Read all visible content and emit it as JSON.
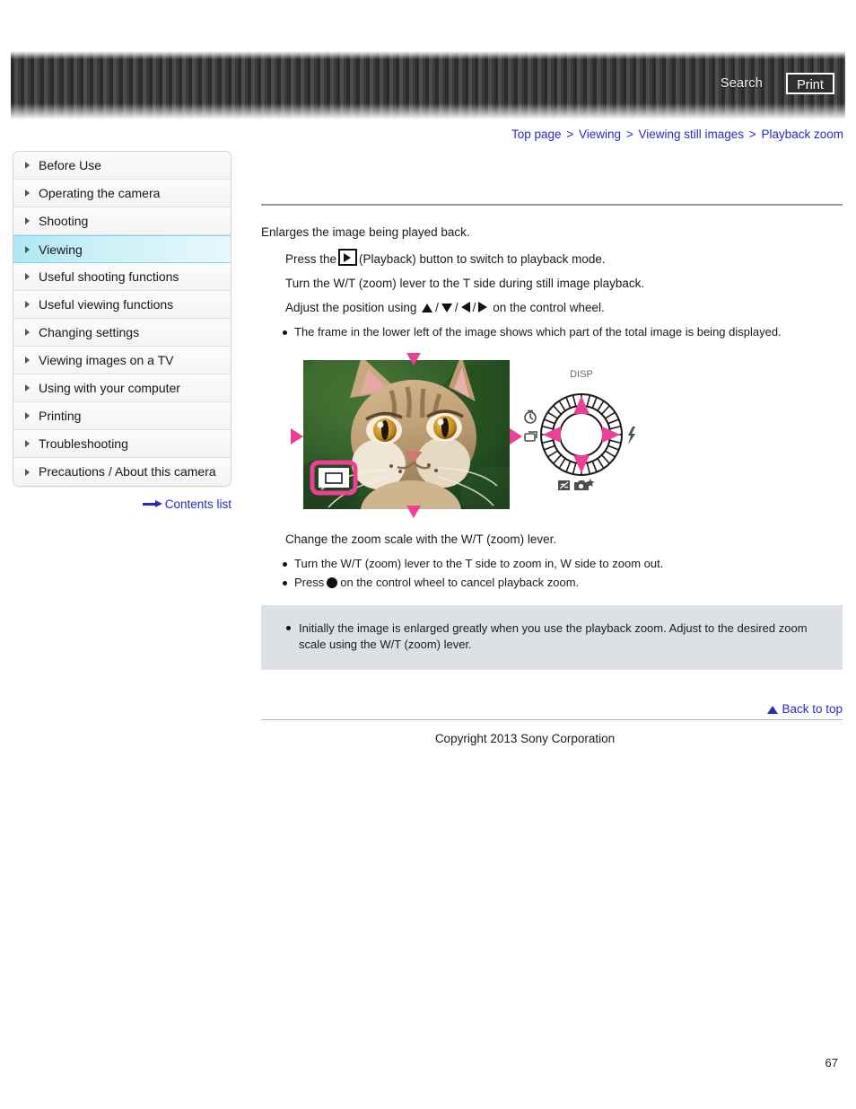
{
  "header": {
    "search_label": "Search",
    "print_label": "Print"
  },
  "breadcrumb": {
    "items": [
      "Top page",
      "Viewing",
      "Viewing still images",
      "Playback zoom"
    ],
    "separator": ">"
  },
  "sidebar": {
    "items": [
      {
        "label": "Before Use",
        "active": false
      },
      {
        "label": "Operating the camera",
        "active": false
      },
      {
        "label": "Shooting",
        "active": false
      },
      {
        "label": "Viewing",
        "active": true
      },
      {
        "label": "Useful shooting functions",
        "active": false
      },
      {
        "label": "Useful viewing functions",
        "active": false
      },
      {
        "label": "Changing settings",
        "active": false
      },
      {
        "label": "Viewing images on a TV",
        "active": false
      },
      {
        "label": "Using with your computer",
        "active": false
      },
      {
        "label": "Printing",
        "active": false
      },
      {
        "label": "Troubleshooting",
        "active": false
      },
      {
        "label": "Precautions / About this camera",
        "active": false
      }
    ],
    "contents_list_label": "Contents list"
  },
  "main": {
    "lead": "Enlarges the image being played back.",
    "step1_pre": "Press the",
    "step1_post": "(Playback) button to switch to playback mode.",
    "step2": "Turn the W/T (zoom) lever to the T side during still image playback.",
    "step3_pre": "Adjust the position using",
    "step3_post": "on the control wheel.",
    "step3_note": "The frame in the lower left of the image shows which part of the total image is being displayed.",
    "step4": "Change the zoom scale with the W/T (zoom) lever.",
    "step4_note1": "Turn the W/T (zoom) lever to the T side to zoom in, W side to zoom out.",
    "step4_note2_pre": "Press",
    "step4_note2_post": "on the control wheel to cancel playback zoom."
  },
  "illustration": {
    "wheel_labels": {
      "top": "DISP",
      "left_upper": "self-timer-icon",
      "left_lower": "burst-icon",
      "right": "flash-icon",
      "bottom_left": "exposure-comp-icon",
      "bottom_right": "photo-creativity-icon"
    },
    "frame_indicator": "position-frame-icon",
    "photo_subject": "cat-photo"
  },
  "note": {
    "text": "Initially the image is enlarged greatly when you use the playback zoom. Adjust to the desired zoom scale using the W/T (zoom) lever."
  },
  "footer": {
    "back_to_top_label": "Back to top",
    "copyright": "Copyright 2013 Sony Corporation",
    "page_number": "67"
  },
  "colors": {
    "link": "#2a2ac0",
    "accent_pink": "#ec4899",
    "note_bg": "#dde1e6",
    "active_nav": "#aee7f2"
  }
}
